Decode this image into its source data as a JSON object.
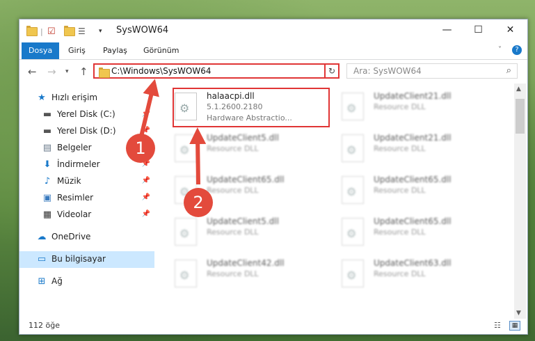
{
  "window": {
    "title": "SysWOW64"
  },
  "ribbon": {
    "tabs": [
      "Dosya",
      "Giriş",
      "Paylaş",
      "Görünüm"
    ]
  },
  "address": {
    "path": "C:\\Windows\\SysWOW64"
  },
  "search": {
    "placeholder": "Ara: SysWOW64"
  },
  "sidebar": {
    "items": [
      {
        "label": "Hızlı erişim"
      },
      {
        "label": "Yerel Disk (C:)"
      },
      {
        "label": "Yerel Disk (D:)"
      },
      {
        "label": "Belgeler"
      },
      {
        "label": "İndirmeler"
      },
      {
        "label": "Müzik"
      },
      {
        "label": "Resimler"
      },
      {
        "label": "Videolar"
      },
      {
        "label": "OneDrive"
      },
      {
        "label": "Bu bilgisayar"
      },
      {
        "label": "Ağ"
      }
    ]
  },
  "files": [
    {
      "name": "halaacpi.dll",
      "version": "5.1.2600.2180",
      "desc": "Hardware Abstractio..."
    },
    {
      "name": "UpdateClient21.dll",
      "type": "Resource DLL"
    },
    {
      "name": "UpdateClient5.dll",
      "type": "Resource DLL"
    },
    {
      "name": "UpdateClient21.dll",
      "type": "Resource DLL"
    },
    {
      "name": "UpdateClient65.dll",
      "type": "Resource DLL"
    },
    {
      "name": "UpdateClient65.dll",
      "type": "Resource DLL"
    },
    {
      "name": "UpdateClient5.dll",
      "type": "Resource DLL"
    },
    {
      "name": "UpdateClient65.dll",
      "type": "Resource DLL"
    },
    {
      "name": "UpdateClient42.dll",
      "type": "Resource DLL"
    },
    {
      "name": "UpdateClient63.dll",
      "type": "Resource DLL"
    }
  ],
  "status": {
    "count": "112 öğe"
  },
  "callouts": [
    "1",
    "2"
  ],
  "colors": {
    "accent": "#1979ca",
    "highlight": "#e03535",
    "callout": "#e34a3c"
  }
}
